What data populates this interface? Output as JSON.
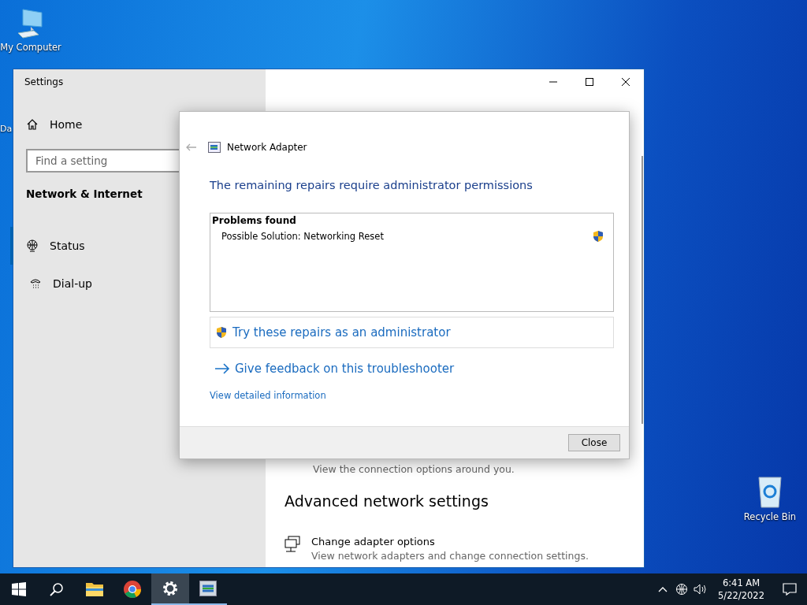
{
  "desktop_icons": [
    {
      "kind": "computer",
      "label": "My Computer"
    },
    {
      "kind": "partial",
      "label": "Da"
    },
    {
      "kind": "recycle",
      "label": "Recycle Bin"
    }
  ],
  "settings_window": {
    "title": "Settings",
    "home": "Home",
    "search": {
      "placeholder": "Find a setting"
    },
    "section": "Network & Internet",
    "nav": [
      {
        "kind": "globe",
        "label": "Status",
        "selected": true
      },
      {
        "kind": "phone",
        "label": "Dial-up",
        "selected": false
      }
    ],
    "content": {
      "hidden_description": "View the connection options around you.",
      "heading": "Advanced network settings",
      "items": [
        {
          "title": "Change adapter options",
          "description": "View network adapters and change connection settings."
        }
      ]
    }
  },
  "dialog": {
    "title": "Network Adapter",
    "heading": "The remaining repairs require administrator permissions",
    "problems": {
      "header": "Problems found",
      "items": [
        {
          "text": "Possible Solution: Networking Reset",
          "shield": true
        }
      ]
    },
    "admin_action": "Try these repairs as an administrator",
    "feedback": "Give feedback on this troubleshooter",
    "details_link": "View detailed information",
    "close_button": "Close"
  },
  "taskbar": {
    "apps": [
      {
        "kind": "folder",
        "running": false,
        "selected": false
      },
      {
        "kind": "browser",
        "running": false,
        "selected": false
      },
      {
        "kind": "gear",
        "running": true,
        "selected": true
      },
      {
        "kind": "adapter",
        "running": true,
        "selected": false
      }
    ],
    "time": "6:41 AM",
    "date": "5/22/2022"
  }
}
